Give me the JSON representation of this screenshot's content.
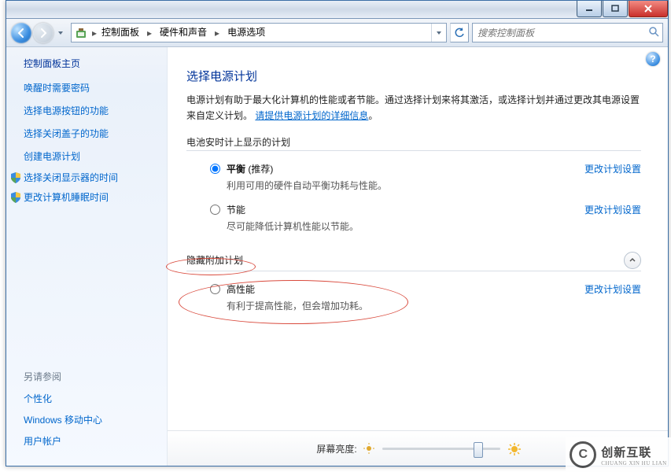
{
  "titlebar": {
    "min": "minimize",
    "max": "maximize",
    "close": "close"
  },
  "breadcrumbs": [
    "控制面板",
    "硬件和声音",
    "电源选项"
  ],
  "search": {
    "placeholder": "搜索控制面板"
  },
  "sidebar": {
    "home": "控制面板主页",
    "links": [
      "唤醒时需要密码",
      "选择电源按钮的功能",
      "选择关闭盖子的功能",
      "创建电源计划"
    ],
    "iconlinks": [
      "选择关闭显示器的时间",
      "更改计算机睡眠时间"
    ]
  },
  "seealso": {
    "hdr": "另请参阅",
    "links": [
      "个性化",
      "Windows 移动中心",
      "用户帐户"
    ]
  },
  "main": {
    "title": "选择电源计划",
    "desc1": "电源计划有助于最大化计算机的性能或者节能。通过选择计划来将其激活，或选择计划并通过更改其电源设置来自定义计划。",
    "more_link": "请提供电源计划的详细信息",
    "group1": "电池安时计上显示的计划",
    "group2": "隐藏附加计划",
    "change": "更改计划设置",
    "plans": [
      {
        "name": "平衡",
        "suffix": " (推荐)",
        "desc": "利用可用的硬件自动平衡功耗与性能。"
      },
      {
        "name": "节能",
        "suffix": "",
        "desc": "尽可能降低计算机性能以节能。"
      }
    ],
    "plans2": [
      {
        "name": "高性能",
        "suffix": "",
        "desc": "有利于提高性能，但会增加功耗。"
      }
    ]
  },
  "bottom": {
    "label": "屏幕亮度:"
  },
  "watermark": {
    "l1": "创新互联",
    "l2": "CHUANG XIN HU LIAN"
  }
}
